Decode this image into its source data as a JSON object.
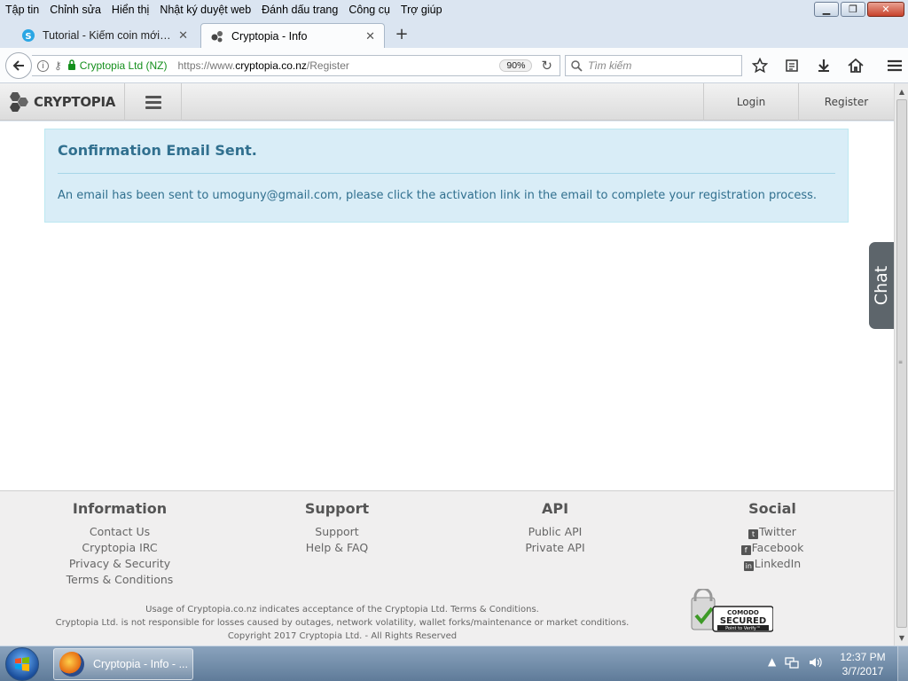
{
  "menu": [
    "Tập tin",
    "Chỉnh sửa",
    "Hiển thị",
    "Nhật ký duyệt web",
    "Đánh dấu trang",
    "Công cụ",
    "Trợ giúp"
  ],
  "tabs": [
    {
      "label": "Tutorial - Kiếm coin mới b..."
    },
    {
      "label": "Cryptopia - Info"
    }
  ],
  "urlbar": {
    "site_identity": "Cryptopia Ltd (NZ)",
    "url_prefix": "https://www.",
    "url_domain": "cryptopia.co.nz",
    "url_path": "/Register",
    "zoom": "90%"
  },
  "search": {
    "placeholder": "Tìm kiếm"
  },
  "site_header": {
    "logo_text": "CRYPTOPIA",
    "login": "Login",
    "register": "Register"
  },
  "alert": {
    "title": "Confirmation Email Sent.",
    "message": "An email has been sent to umoguny@gmail.com, please click the activation link in the email to complete your registration process."
  },
  "chat": {
    "label": "Chat"
  },
  "footer": {
    "columns": [
      {
        "title": "Information",
        "links": [
          "Contact Us",
          "Cryptopia IRC",
          "Privacy & Security",
          "Terms & Conditions"
        ]
      },
      {
        "title": "Support",
        "links": [
          "Support",
          "Help & FAQ"
        ]
      },
      {
        "title": "API",
        "links": [
          "Public API",
          "Private API"
        ]
      },
      {
        "title": "Social",
        "links": [
          "Twitter",
          "Facebook",
          "LinkedIn"
        ]
      }
    ],
    "legal": [
      "Usage of Cryptopia.co.nz indicates acceptance of the Cryptopia Ltd. Terms & Conditions.",
      "Cryptopia Ltd. is not responsible for losses caused by outages, network volatility, wallet forks/maintenance or market conditions.",
      "Copyright 2017 Cryptopia Ltd. - All Rights Reserved"
    ],
    "badge": {
      "brand": "COMODO",
      "status": "SECURED",
      "action": "Point to Verify™"
    }
  },
  "taskbar": {
    "item_label": "Cryptopia - Info - ...",
    "time": "12:37 PM",
    "date": "3/7/2017"
  },
  "colors": {
    "alert_bg": "#d9edf7",
    "alert_text": "#31708f",
    "secure_green": "#148f1c"
  }
}
